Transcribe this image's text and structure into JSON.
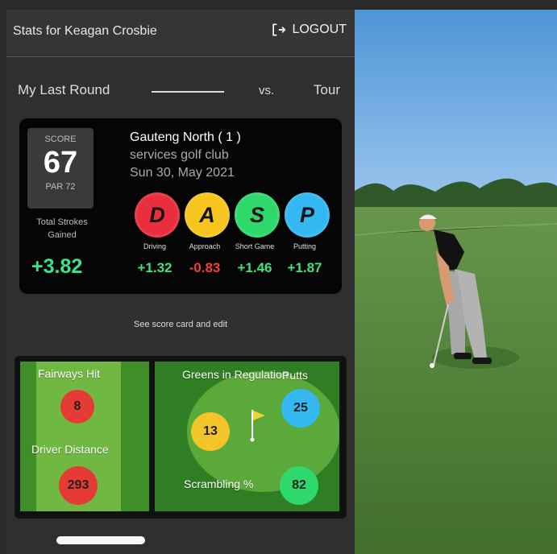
{
  "header": {
    "title": "Stats for Keagan Crosbie",
    "logout_label": "LOGOUT"
  },
  "comparison": {
    "left": "My Last Round",
    "vs": "vs.",
    "right": "Tour"
  },
  "score_card": {
    "score_label": "SCORE",
    "score": "67",
    "par_label": "PAR 72",
    "total_label": "Total Strokes Gained",
    "total_value": "+3.82",
    "course_name": "Gauteng North ( 1 )",
    "club": "services golf club",
    "date": "Sun 30, May 2021",
    "categories": [
      {
        "letter": "D",
        "label": "Driving",
        "value": "+1.32",
        "color": "#e92f3d",
        "value_color": "#43e07d"
      },
      {
        "letter": "A",
        "label": "Approach",
        "value": "-0.83",
        "color": "#f6c51f",
        "value_color": "#f0423a"
      },
      {
        "letter": "S",
        "label": "Short Game",
        "value": "+1.46",
        "color": "#2ed86b",
        "value_color": "#43e07d"
      },
      {
        "letter": "P",
        "label": "Putting",
        "value": "+1.87",
        "color": "#34b8f2",
        "value_color": "#43e07d"
      }
    ]
  },
  "see_scorecard": "See score card and edit",
  "field_stats": {
    "fairways_label": "Fairways Hit",
    "fairways_value": "8",
    "driver_label": "Driver Distance",
    "driver_value": "293",
    "greens_label": "Greens in Regulation",
    "greens_value": "13",
    "putts_label": "Putts",
    "putts_value": "25",
    "scrambling_label": "Scrambling %",
    "scrambling_value": "82",
    "colors": {
      "fairways": "#e63a35",
      "driver": "#e63a35",
      "greens": "#f4c52a",
      "putts": "#34b8f2",
      "scrambling": "#2ed86b"
    }
  }
}
